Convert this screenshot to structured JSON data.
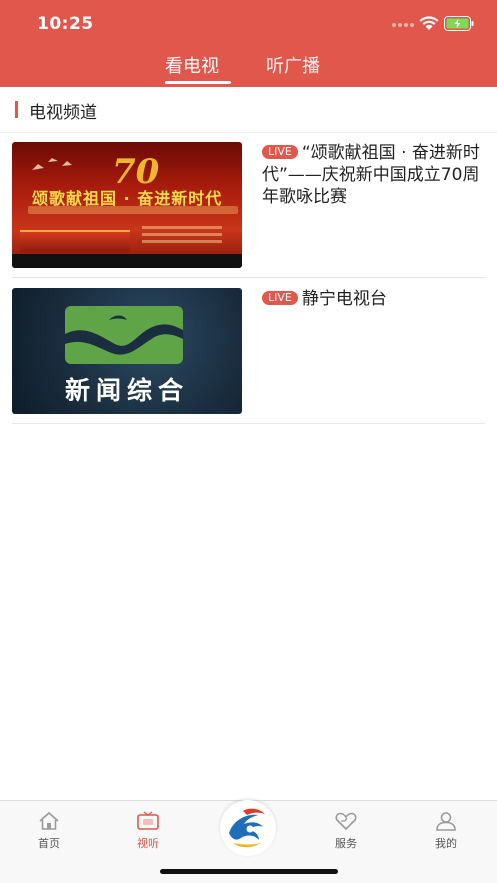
{
  "status_bar": {
    "time": "10:25"
  },
  "header": {
    "tabs": [
      {
        "label": "看电视",
        "active": true
      },
      {
        "label": "听广播",
        "active": false
      }
    ]
  },
  "section": {
    "title": "电视频道"
  },
  "channels": [
    {
      "badge": "LIVE",
      "title": "“颂歌献祖国 · 奋进新时代”——庆祝新中国成立70周年歌咏比赛",
      "thumb_text": "颂歌献祖国 · 奋进新时代",
      "thumb_badge": "70"
    },
    {
      "badge": "LIVE",
      "title": "静宁电视台",
      "thumb_text": "新闻综合"
    }
  ],
  "tabbar": {
    "items": [
      {
        "label": "首页",
        "icon": "home-icon",
        "active": false
      },
      {
        "label": "视听",
        "icon": "tv-icon",
        "active": true
      },
      {
        "label": "服务",
        "icon": "heart-icon",
        "active": false
      },
      {
        "label": "我的",
        "icon": "user-icon",
        "active": false
      }
    ]
  },
  "colors": {
    "accent": "#e2574c",
    "tab_active": "#e2574c",
    "tab_inactive": "#555555"
  }
}
